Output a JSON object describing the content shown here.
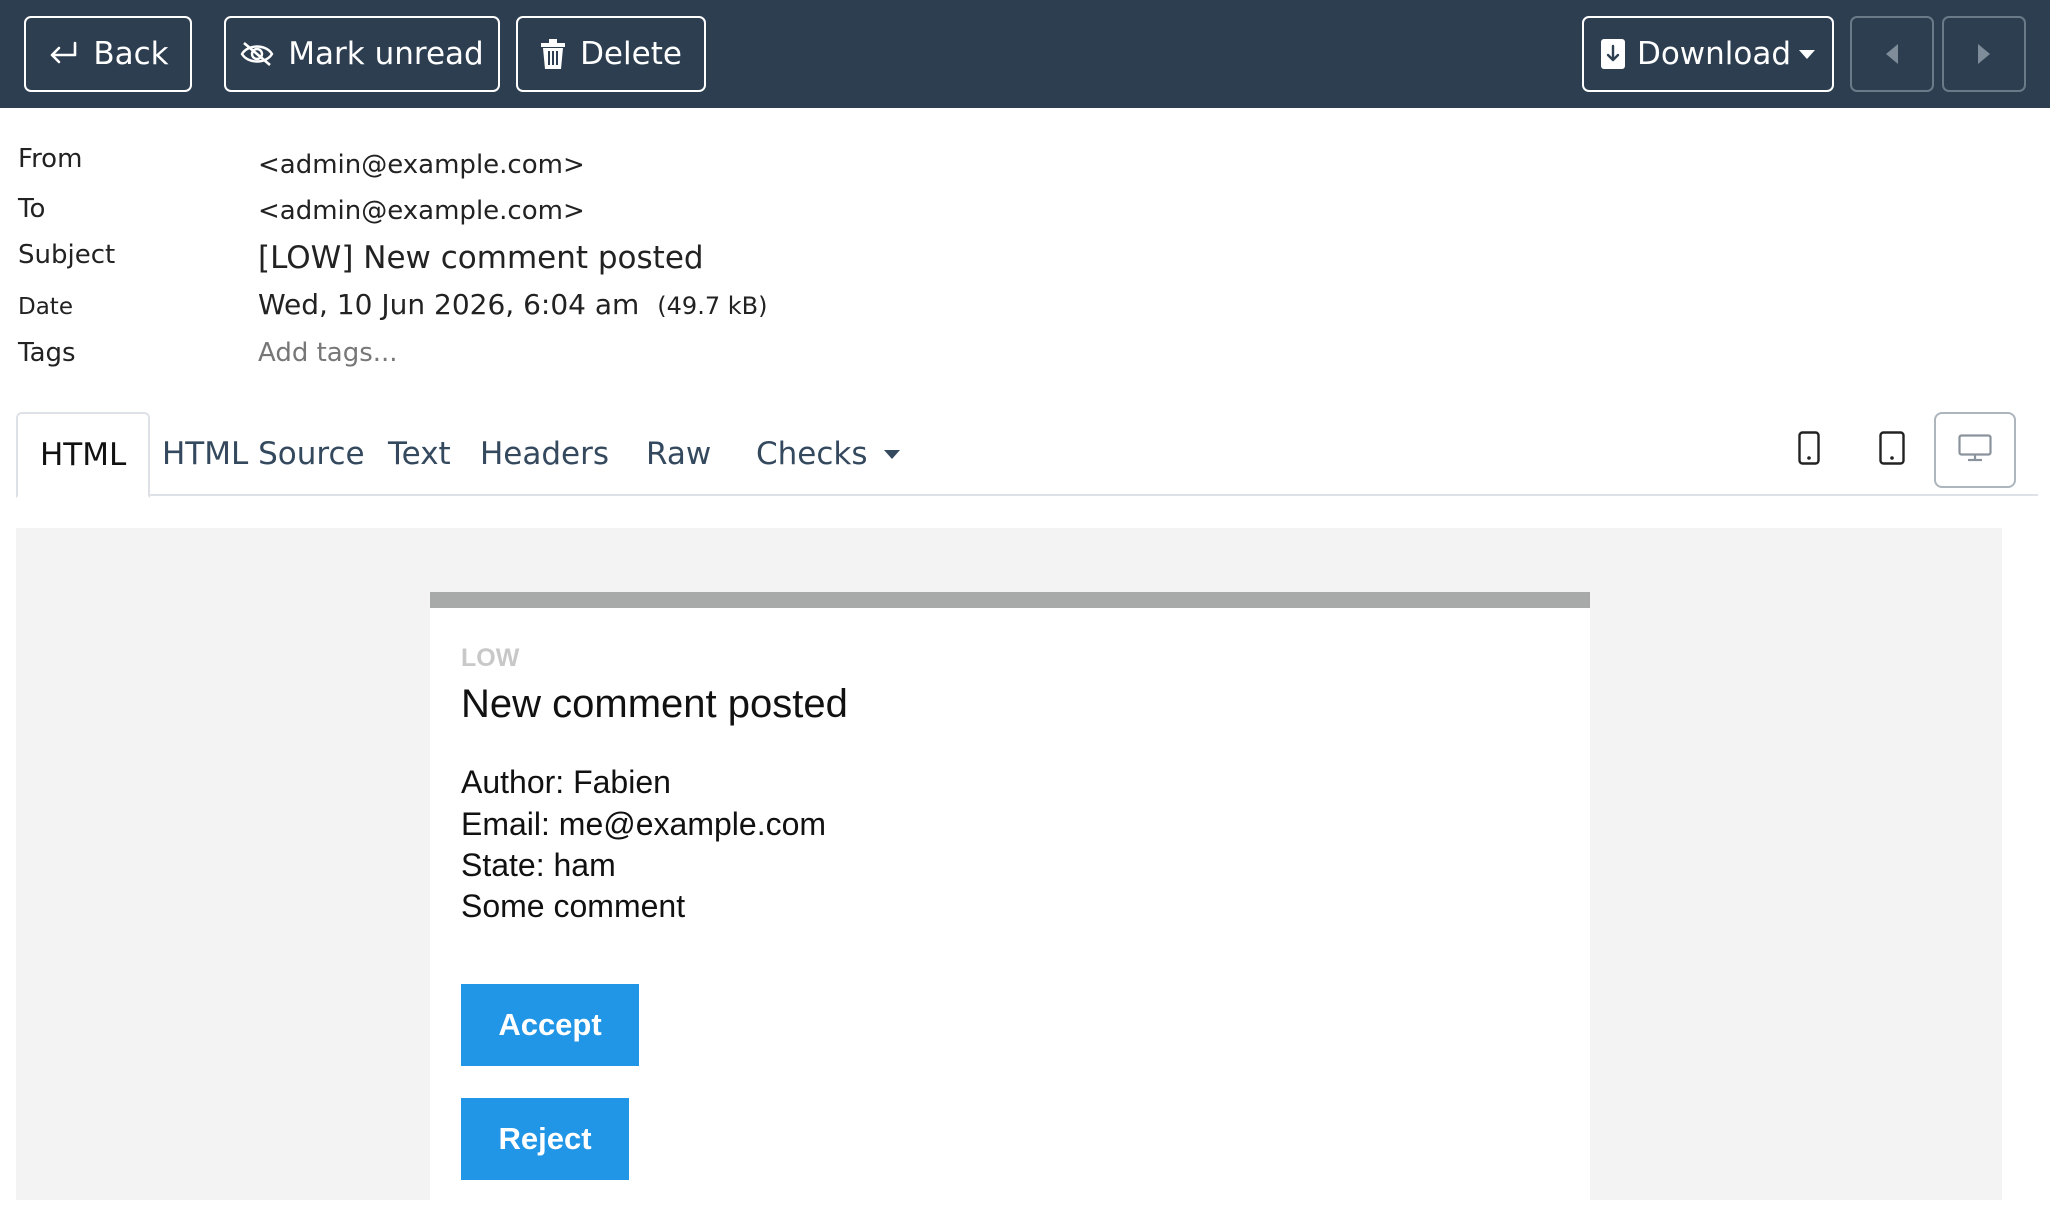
{
  "toolbar": {
    "back_label": "Back",
    "mark_unread_label": "Mark unread",
    "delete_label": "Delete",
    "download_label": "Download"
  },
  "headers": {
    "from_label": "From",
    "from_value": "<admin@example.com>",
    "to_label": "To",
    "to_value": "<admin@example.com>",
    "subject_label": "Subject",
    "subject_value": "[LOW] New comment posted",
    "date_label": "Date",
    "date_value": "Wed, 10 Jun 2026, 6:04 am",
    "size_value": "(49.7 kB)",
    "tags_label": "Tags",
    "tags_placeholder": "Add tags..."
  },
  "tabs": [
    {
      "label": "HTML",
      "active": true
    },
    {
      "label": "HTML Source"
    },
    {
      "label": "Text"
    },
    {
      "label": "Headers"
    },
    {
      "label": "Raw"
    },
    {
      "label": "Checks"
    }
  ],
  "devices": {
    "active": "desktop"
  },
  "email": {
    "level": "LOW",
    "title": "New comment posted",
    "author": "Author: Fabien",
    "email": "Email: me@example.com",
    "state": "State: ham",
    "comment": "Some comment",
    "accept_label": "Accept",
    "reject_label": "Reject"
  },
  "colors": {
    "toolbar_bg": "#2c3e50",
    "accent_button": "#2196e6",
    "preview_bg": "#f3f3f3"
  }
}
